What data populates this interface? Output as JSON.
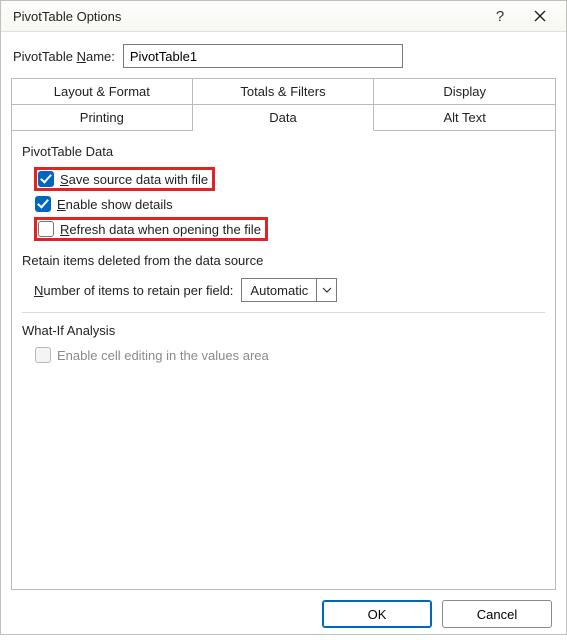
{
  "titlebar": {
    "title": "PivotTable Options"
  },
  "name": {
    "label_pre": "PivotTable ",
    "label_u": "N",
    "label_post": "ame:",
    "value": "PivotTable1"
  },
  "tabs": {
    "row1": [
      "Layout & Format",
      "Totals & Filters",
      "Display"
    ],
    "row2": [
      "Printing",
      "Data",
      "Alt Text"
    ],
    "active": "Data"
  },
  "data_tab": {
    "section1_label": "PivotTable Data",
    "save_source": {
      "u": "S",
      "rest": "ave source data with file",
      "checked": true
    },
    "enable_show_details": {
      "u": "E",
      "rest": "nable show details",
      "checked": true
    },
    "refresh_open": {
      "u": "R",
      "rest": "efresh data when opening the file",
      "checked": false
    },
    "retain_heading": "Retain items deleted from the data source",
    "retain_field": {
      "u": "N",
      "rest": "umber of items to retain per field:",
      "value": "Automatic"
    },
    "whatif_heading": "What-If Analysis",
    "enable_cell_edit": {
      "label": "Enable cell editing in the values area",
      "checked": false,
      "disabled": true
    }
  },
  "footer": {
    "ok": "OK",
    "cancel": "Cancel"
  }
}
